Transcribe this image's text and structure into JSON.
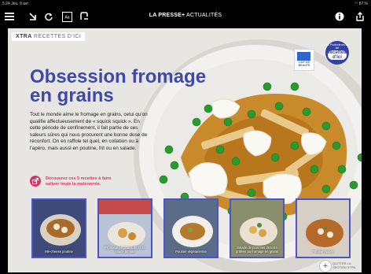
{
  "status_bar": {
    "left": "5:24  Jeu. 9 avr.",
    "right": "87 %"
  },
  "toolbar": {
    "menu_icon": "menu-icon",
    "title_brand": "LA PRESSE+",
    "title_section": " ACTUALITÉS"
  },
  "section_tag": {
    "prefix": "XTRA",
    "label": " RECETTES D'ICI"
  },
  "headline": "Obsession fromage en grains",
  "lede": "Tout le monde aime le fromage en grains, celui qu'on qualifie affectueusement de « squick squick ». En cette période de confinement, il fait partie de ces valeurs sûres qui nous procurent une bonne dose de réconfort. On en raffole tel quel, en collation ou à l'apéro, mais aussi en poutine, frit ou en salade.",
  "cta": "Découvrez ces 5 recettes à faire saliver toute la maisonnée.",
  "badges": {
    "lait_text": "LAIT DE BEAUTÉ",
    "recettes_small": "les Producteurs de lait",
    "recettes_main": "recettes d'ici"
  },
  "thumbnails": [
    {
      "caption": "Mé-cheese poutine"
    },
    {
      "caption": "Fromage en grains frit et sa sauce tomate"
    },
    {
      "caption": "Poutine végétarienne"
    },
    {
      "caption": "Salade de pommes de terre grillées au fromage en grains"
    },
    {
      "caption": "Poutine épicée"
    }
  ],
  "fab": {
    "label": "QUITTER LA SECTION XTRA"
  },
  "colors": {
    "headline": "#3f4aa6",
    "accent_pink": "#e0306b",
    "thumb_border": "#4b55c9"
  }
}
